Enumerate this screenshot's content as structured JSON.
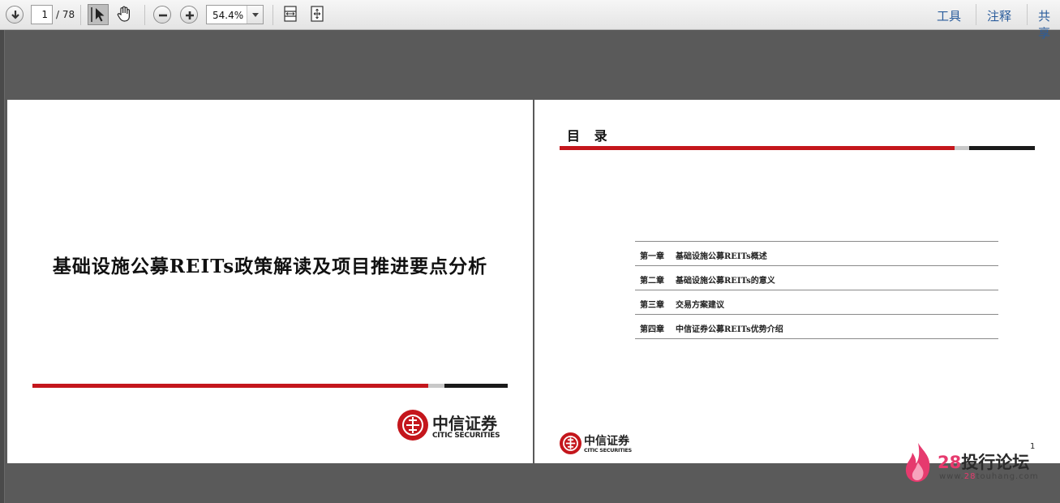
{
  "toolbar": {
    "current_page": "1",
    "total_pages": "/ 78",
    "zoom": "54.4%",
    "right_links": [
      "工具",
      "注释",
      "共享"
    ],
    "icons": [
      "download-icon",
      "select-tool-icon",
      "hand-tool-icon",
      "zoom-out-icon",
      "zoom-in-icon",
      "fit-width-icon",
      "fit-page-icon"
    ]
  },
  "colors": {
    "accent_red": "#c4161c",
    "link_blue": "#2b5d9c",
    "viewer_bg": "#5a5a5a"
  },
  "page1": {
    "title": "基础设施公募REITs政策解读及项目推进要点分析",
    "logo_cn": "中信证券",
    "logo_en": "CITIC SECURITIES"
  },
  "page2": {
    "heading": "目 录",
    "toc": [
      {
        "chapter": "第一章",
        "title": "基础设施公募REITs概述"
      },
      {
        "chapter": "第二章",
        "title": "基础设施公募REITs的意义"
      },
      {
        "chapter": "第三章",
        "title": "交易方案建议"
      },
      {
        "chapter": "第四章",
        "title": "中信证券公募REITs优势介绍"
      }
    ],
    "page_number": "1",
    "logo_cn": "中信证券",
    "logo_en": "CITIC SECURITIES"
  },
  "watermark": {
    "num": "28",
    "text": "投行论坛",
    "url_prefix": "www.",
    "url_num": "28",
    "url_suffix": "touhang.com"
  }
}
